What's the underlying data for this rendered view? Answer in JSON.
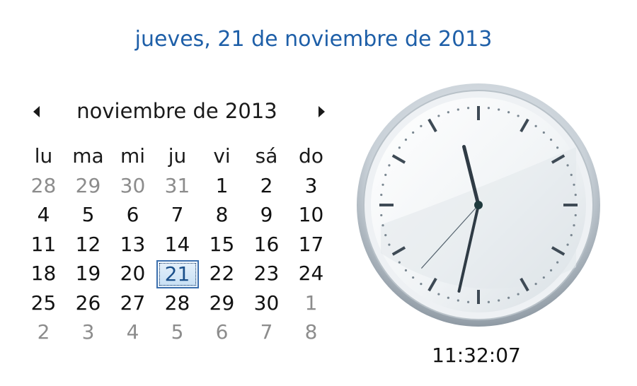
{
  "header": {
    "full_date": "jueves, 21 de noviembre de 2013"
  },
  "calendar": {
    "month_title": "noviembre de 2013",
    "weekdays": [
      "lu",
      "ma",
      "mi",
      "ju",
      "vi",
      "sá",
      "do"
    ],
    "weeks": [
      [
        {
          "d": "28",
          "muted": true
        },
        {
          "d": "29",
          "muted": true
        },
        {
          "d": "30",
          "muted": true
        },
        {
          "d": "31",
          "muted": true
        },
        {
          "d": "1"
        },
        {
          "d": "2"
        },
        {
          "d": "3"
        }
      ],
      [
        {
          "d": "4"
        },
        {
          "d": "5"
        },
        {
          "d": "6"
        },
        {
          "d": "7"
        },
        {
          "d": "8"
        },
        {
          "d": "9"
        },
        {
          "d": "10"
        }
      ],
      [
        {
          "d": "11"
        },
        {
          "d": "12"
        },
        {
          "d": "13"
        },
        {
          "d": "14"
        },
        {
          "d": "15"
        },
        {
          "d": "16"
        },
        {
          "d": "17"
        }
      ],
      [
        {
          "d": "18"
        },
        {
          "d": "19"
        },
        {
          "d": "20"
        },
        {
          "d": "21",
          "today": true
        },
        {
          "d": "22"
        },
        {
          "d": "23"
        },
        {
          "d": "24"
        }
      ],
      [
        {
          "d": "25"
        },
        {
          "d": "26"
        },
        {
          "d": "27"
        },
        {
          "d": "28"
        },
        {
          "d": "29"
        },
        {
          "d": "30"
        },
        {
          "d": "1",
          "muted": true
        }
      ],
      [
        {
          "d": "2",
          "muted": true
        },
        {
          "d": "3",
          "muted": true
        },
        {
          "d": "4",
          "muted": true
        },
        {
          "d": "5",
          "muted": true
        },
        {
          "d": "6",
          "muted": true
        },
        {
          "d": "7",
          "muted": true
        },
        {
          "d": "8",
          "muted": true
        }
      ]
    ],
    "prev_icon": "triangle-left-icon",
    "next_icon": "triangle-right-icon"
  },
  "clock": {
    "time_text": "11:32:07",
    "hours": 11,
    "minutes": 32,
    "seconds": 7
  },
  "colors": {
    "date_link": "#1e5fa8",
    "today_border": "#3b6fae",
    "muted_day": "#8c8c8c"
  }
}
